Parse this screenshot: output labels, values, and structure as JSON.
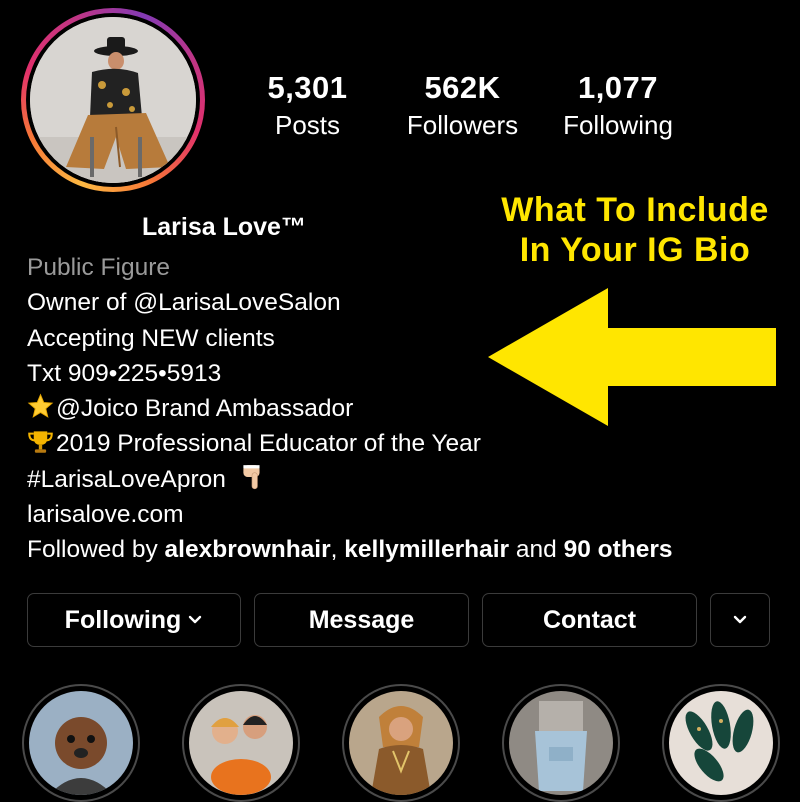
{
  "profile": {
    "display_name": "Larisa Love™",
    "category": "Public Figure",
    "avatar_alt": "profile-photo"
  },
  "stats": {
    "posts": {
      "value": "5,301",
      "label": "Posts"
    },
    "followers": {
      "value": "562K",
      "label": "Followers"
    },
    "following": {
      "value": "1,077",
      "label": "Following"
    }
  },
  "overlay": {
    "title_line1": "What To Include",
    "title_line2": "In Your IG Bio",
    "color": "#ffe600"
  },
  "bio": {
    "line1": "Owner of @LarisaLoveSalon",
    "line2": "Accepting NEW clients",
    "line3": "Txt 909•225•5913",
    "line4": "@Joico Brand Ambassador",
    "line5": "2019 Professional Educator of the Year",
    "line6": "#LarisaLoveApron",
    "link": "larisalove.com",
    "followed_prefix": "Followed by ",
    "followed_user1": "alexbrownhair",
    "followed_sep": ", ",
    "followed_user2": "kellymillerhair",
    "followed_and": " and ",
    "followed_others": "90 others",
    "icons": [
      "star-emoji",
      "trophy-emoji",
      "pointing-down-emoji"
    ]
  },
  "buttons": {
    "following": "Following",
    "message": "Message",
    "contact": "Contact"
  },
  "highlights": [
    "highlight-dog",
    "highlight-pumpkins",
    "highlight-style",
    "highlight-apron",
    "highlight-nails"
  ]
}
